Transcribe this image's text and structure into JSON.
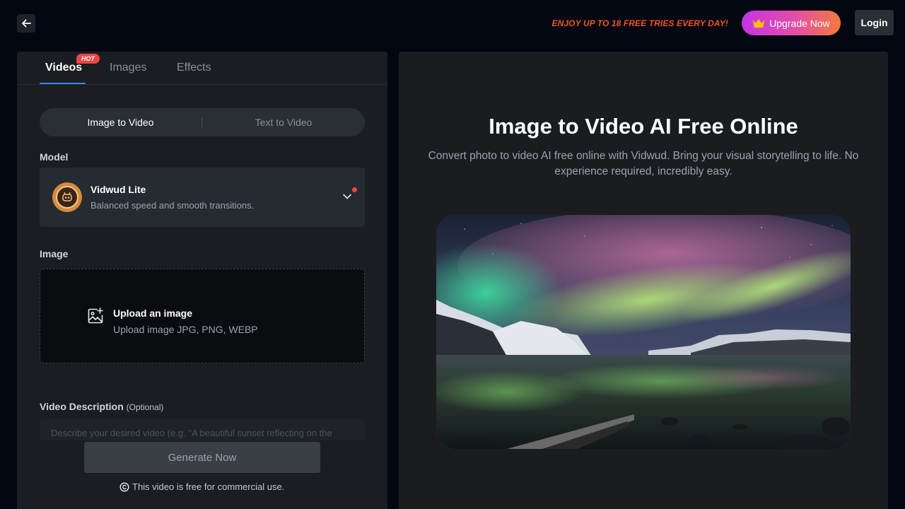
{
  "topbar": {
    "promo": "ENJOY UP TO 18 FREE TRIES EVERY DAY!",
    "upgrade_label": "Upgrade Now",
    "login_label": "Login"
  },
  "tabs": [
    {
      "label": "Videos",
      "badge": "HOT",
      "active": true
    },
    {
      "label": "Images",
      "active": false
    },
    {
      "label": "Effects",
      "active": false
    }
  ],
  "mode": {
    "options": [
      "Image to Video",
      "Text to Video"
    ],
    "selected": "Image to Video"
  },
  "model": {
    "section_label": "Model",
    "name": "Vidwud Lite",
    "description": "Balanced speed and smooth transitions."
  },
  "image": {
    "section_label": "Image",
    "upload_title": "Upload an image",
    "upload_sub": "Upload image JPG, PNG, WEBP"
  },
  "description": {
    "label": "Video Description",
    "optional": "(Optional)",
    "placeholder": "Describe your desired video (e.g. \"A beautiful sunset reflecting on the"
  },
  "generate_label": "Generate Now",
  "license_text": "This video is free for commercial use.",
  "hero": {
    "title": "Image to Video AI Free Online",
    "subtitle": "Convert photo to video AI free online with Vidwud. Bring your visual storytelling to life. No experience required, incredibly easy."
  },
  "colors": {
    "background": "#030712",
    "panel": "#1a1d22",
    "accent_tab": "#3b82f6",
    "promo": "#f0551d",
    "hot_badge": "#ef4444"
  },
  "icons": [
    "back-arrow-icon",
    "crown-icon",
    "chevron-down-icon",
    "image-plus-icon",
    "copyright-icon"
  ]
}
